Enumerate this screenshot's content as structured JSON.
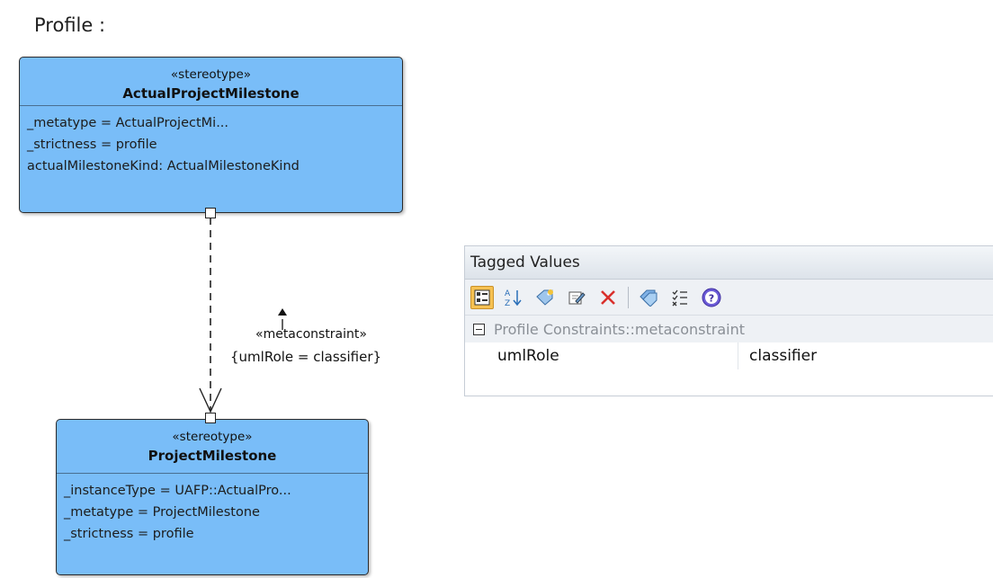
{
  "heading": "Profile :",
  "classes": {
    "actual": {
      "stereotype": "«stereotype»",
      "name": "ActualProjectMilestone",
      "attributes": [
        "_metatype = ActualProjectMi...",
        "_strictness = profile",
        "actualMilestoneKind: ActualMilestoneKind"
      ]
    },
    "project": {
      "stereotype": "«stereotype»",
      "name": "ProjectMilestone",
      "attributes": [
        "_instanceType = UAFP::ActualPro...",
        "_metatype = ProjectMilestone",
        "_strictness = profile"
      ]
    }
  },
  "connector": {
    "stereotype": "«metaconstraint»",
    "constraint": "{umlRole = classifier}"
  },
  "tagged_values": {
    "title": "Tagged Values",
    "toolbar": [
      "categorized-icon",
      "sort-az-icon",
      "new-tag-icon",
      "edit-icon",
      "delete-icon",
      "tag-icon",
      "checklist-icon",
      "help-icon"
    ],
    "group": "Profile Constraints::metaconstraint",
    "rows": [
      {
        "name": "umlRole",
        "value": "classifier"
      }
    ]
  },
  "colors": {
    "class_fill": "#79bdf8",
    "active_button": "#f6c152",
    "delete": "#d9302c"
  }
}
